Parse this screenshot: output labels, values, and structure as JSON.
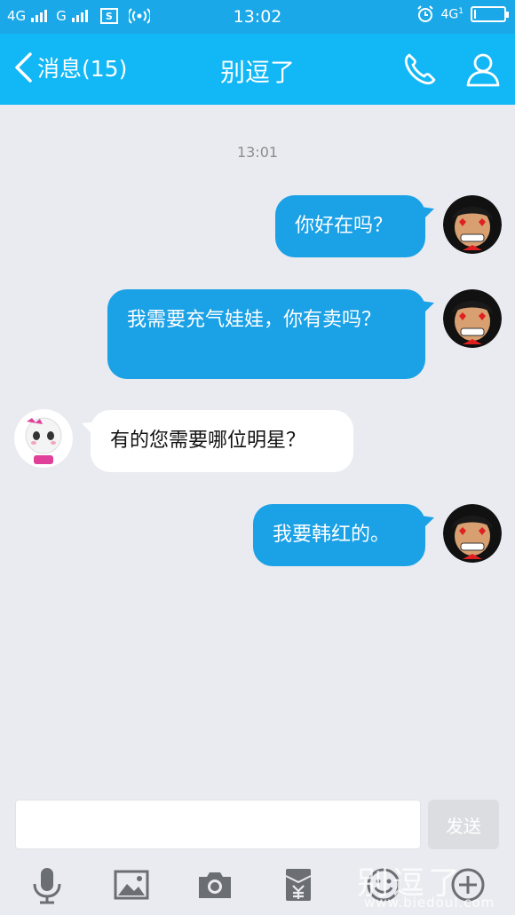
{
  "status_bar": {
    "network1": "4G",
    "network2": "G",
    "sim_icon": "S",
    "time": "13:02",
    "network_right": "4G",
    "network_right_sub": "1",
    "battery_level": 0.05
  },
  "header": {
    "back_label": "消息(15)",
    "title": "别逗了",
    "icons": [
      "phone-icon",
      "profile-icon"
    ]
  },
  "chat": {
    "timestamp": "13:01",
    "messages": [
      {
        "direction": "out",
        "text": "你好在吗？"
      },
      {
        "direction": "out",
        "text": "我需要充气娃娃，你有卖吗？"
      },
      {
        "direction": "in",
        "text": "有的您需要哪位明星？"
      },
      {
        "direction": "out",
        "text": "我要韩红的。"
      }
    ]
  },
  "composer": {
    "input_value": "",
    "send_label": "发送"
  },
  "toolbar": {
    "icons": [
      "microphone-icon",
      "image-icon",
      "camera-icon",
      "red-packet-icon",
      "emoji-icon",
      "plus-icon"
    ]
  },
  "watermark": {
    "text": "别逗了",
    "url": "www.biedoul.com"
  },
  "colors": {
    "header_bg": "#12b7f5",
    "outgoing_bubble": "#1aa1e6",
    "incoming_bubble": "#ffffff",
    "chat_bg": "#e9ebf0"
  }
}
